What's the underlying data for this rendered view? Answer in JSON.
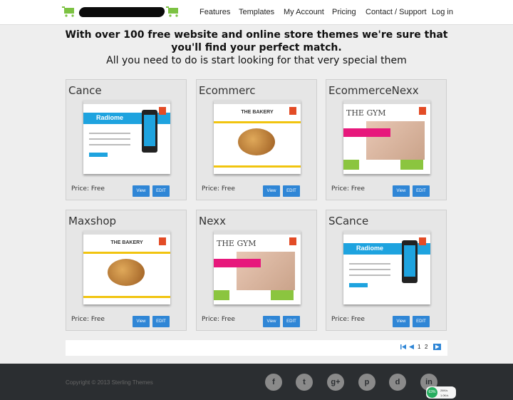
{
  "header": {
    "nav": [
      "Features",
      "Templates",
      "My Account",
      "Pricing",
      "Contact / Support",
      "Log in"
    ]
  },
  "headline": {
    "line1a": "With over 100 free website and online store themes we're sure that",
    "line1b": "you'll find your perfect match.",
    "line2": "All you need to do is start looking for that very special them"
  },
  "themes": [
    {
      "name": "Cance",
      "price": "Price: Free",
      "view": "View",
      "edit": "EDIT",
      "preview": "radiome"
    },
    {
      "name": "Ecommerc",
      "price": "Price: Free",
      "view": "View",
      "edit": "EDIT",
      "preview": "bakery"
    },
    {
      "name": "EcommerceNexx",
      "price": "Price: Free",
      "view": "View",
      "edit": "EDIT",
      "preview": "gym"
    },
    {
      "name": "Maxshop",
      "price": "Price: Free",
      "view": "View",
      "edit": "EDIT",
      "preview": "bakery"
    },
    {
      "name": "Nexx",
      "price": "Price: Free",
      "view": "View",
      "edit": "EDIT",
      "preview": "gym"
    },
    {
      "name": "SCance",
      "price": "Price: Free",
      "view": "View",
      "edit": "EDIT",
      "preview": "radiome"
    }
  ],
  "thumb_text": {
    "radiome": "Radiome",
    "bakery": "THE BAKERY",
    "gym": "THE GYM"
  },
  "pagination": {
    "pages": [
      "1",
      "2"
    ],
    "current": "1"
  },
  "footer": {
    "copyright": "Copyright © 2013 Sterling Themes",
    "social": [
      "f",
      "t",
      "g+",
      "p",
      "d",
      "in"
    ]
  },
  "netmeter": {
    "percent": "63%",
    "up": "26K/s",
    "down": "1.0K/s"
  },
  "colors": {
    "accent": "#2f86d6",
    "footer": "#2b2e31",
    "cart_green": "#7cc242"
  }
}
